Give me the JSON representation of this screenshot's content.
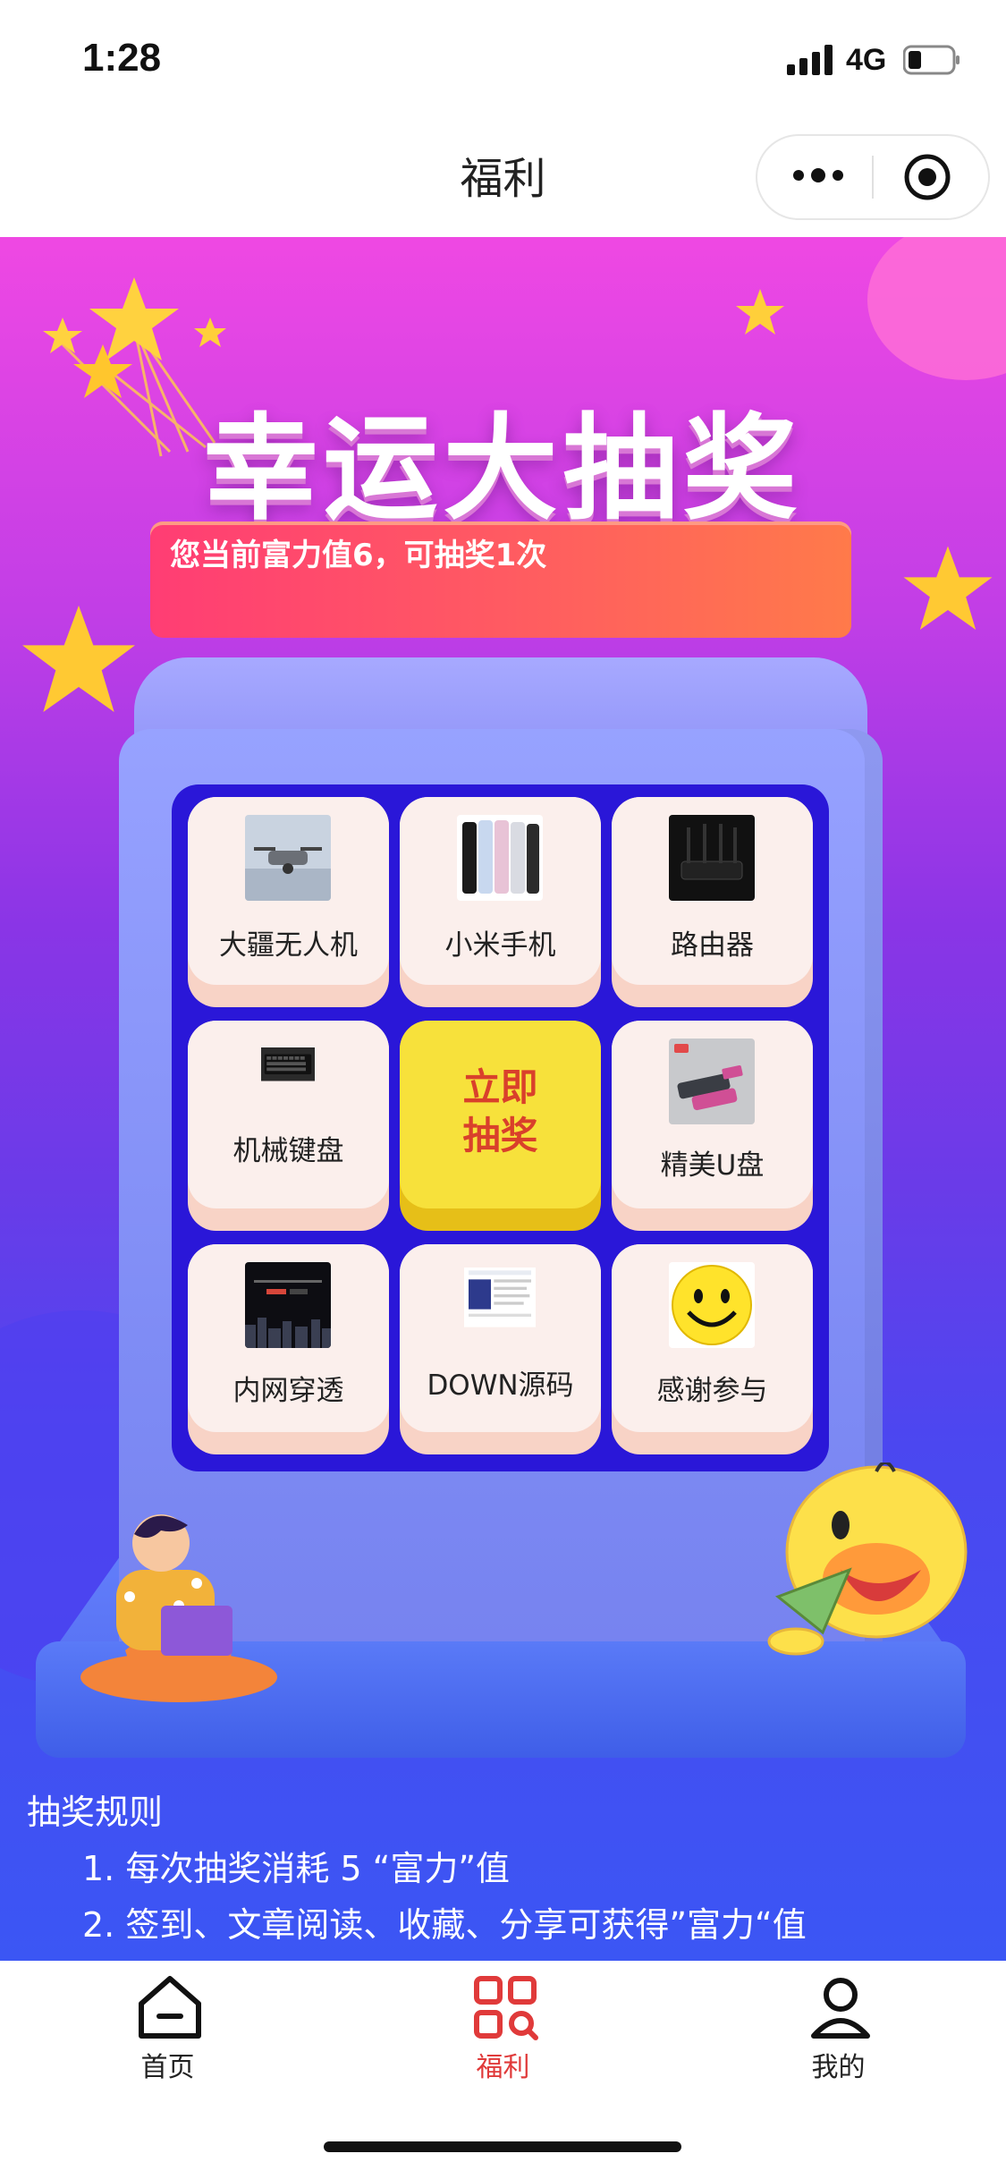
{
  "status_bar": {
    "time": "1:28",
    "network": "4G"
  },
  "title_bar": {
    "title": "福利"
  },
  "hero": {
    "headline": "幸运大抽奖",
    "banner_text": "您当前富力值6，可抽奖1次"
  },
  "prize_grid": {
    "items": [
      {
        "label": "大疆无人机",
        "icon": "drone-image"
      },
      {
        "label": "小米手机",
        "icon": "phone-image"
      },
      {
        "label": "路由器",
        "icon": "router-image"
      },
      {
        "label": "机械键盘",
        "icon": "keyboard-image"
      },
      {
        "label": "精美U盘",
        "icon": "usb-drive-image"
      },
      {
        "label": "内网穿透",
        "icon": "intranet-image"
      },
      {
        "label": "DOWN源码",
        "icon": "source-code-image"
      },
      {
        "label": "感谢参与",
        "icon": "smiley-icon"
      }
    ],
    "draw_button": {
      "line1": "立即",
      "line2": "抽奖"
    }
  },
  "rules": {
    "title": "抽奖规则",
    "items": [
      "1.  每次抽奖消耗 5 “富力”值",
      "2.  签到、文章阅读、收藏、分享可获得”富力“值"
    ]
  },
  "tab_bar": {
    "tabs": [
      {
        "label": "首页",
        "icon": "home-icon",
        "active": false
      },
      {
        "label": "福利",
        "icon": "welfare-icon",
        "active": true
      },
      {
        "label": "我的",
        "icon": "profile-icon",
        "active": false
      }
    ],
    "active_color": "#e03a3a"
  },
  "colors": {
    "bg_top": "#ef48e3",
    "bg_bottom": "#3b56f4",
    "grid": "#2a17d8",
    "draw_button": "#f7e13b"
  }
}
